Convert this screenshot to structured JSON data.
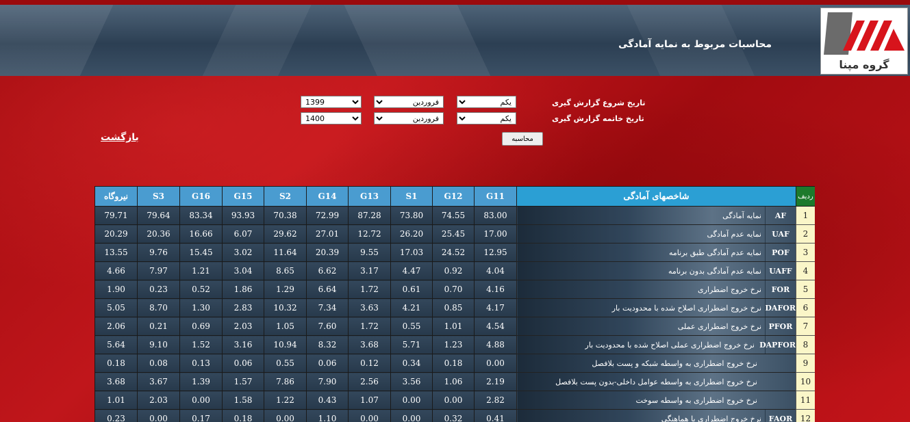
{
  "header": {
    "title": "محاسبات مربوط به نمایه آمادگی",
    "logo_text": "گروه مپنا"
  },
  "form": {
    "start_label": "تاریخ شروع گزارش گیری",
    "end_label": "تاریخ خاتمه گزارش گیری",
    "start_day": "یکم",
    "start_month": "فروردین",
    "start_year": "1399",
    "end_day": "یکم",
    "end_month": "فروردین",
    "end_year": "1400",
    "calc_label": "محاسبه",
    "back_label": "بازگشت"
  },
  "table": {
    "idx_header": "ردیف",
    "name_header": "شاخصهای آمادگی",
    "columns": [
      "G11",
      "G12",
      "S1",
      "G13",
      "G14",
      "S2",
      "G15",
      "G16",
      "S3",
      "نیروگاه"
    ],
    "rows": [
      {
        "idx": "1",
        "abbr": "AF",
        "desc": "نمایه آمادگی",
        "values": [
          "83.00",
          "74.55",
          "73.80",
          "87.28",
          "72.99",
          "70.38",
          "93.93",
          "83.34",
          "79.64",
          "79.71"
        ]
      },
      {
        "idx": "2",
        "abbr": "UAF",
        "desc": "نمایه عدم آمادگی",
        "values": [
          "17.00",
          "25.45",
          "26.20",
          "12.72",
          "27.01",
          "29.62",
          "6.07",
          "16.66",
          "20.36",
          "20.29"
        ]
      },
      {
        "idx": "3",
        "abbr": "POF",
        "desc": "نمایه عدم آمادگی طبق برنامه",
        "values": [
          "12.95",
          "24.52",
          "17.03",
          "9.55",
          "20.39",
          "11.64",
          "3.02",
          "15.45",
          "9.76",
          "13.55"
        ]
      },
      {
        "idx": "4",
        "abbr": "UAFF",
        "desc": "نمایه عدم آمادگی بدون برنامه",
        "values": [
          "4.04",
          "0.92",
          "4.47",
          "3.17",
          "6.62",
          "8.65",
          "3.04",
          "1.21",
          "7.97",
          "4.66"
        ]
      },
      {
        "idx": "5",
        "abbr": "FOR",
        "desc": "نرخ خروج اضطراری",
        "values": [
          "4.16",
          "0.70",
          "0.61",
          "1.72",
          "6.64",
          "1.29",
          "1.86",
          "0.52",
          "0.23",
          "1.90"
        ]
      },
      {
        "idx": "6",
        "abbr": "DAFOR",
        "desc": "نرخ خروج اضطراری اصلاح شده با محدودیت بار",
        "values": [
          "4.17",
          "0.85",
          "4.21",
          "3.63",
          "7.34",
          "10.32",
          "2.83",
          "1.30",
          "8.70",
          "5.05"
        ]
      },
      {
        "idx": "7",
        "abbr": "PFOR",
        "desc": "نرخ خروج اضطراری عملی",
        "values": [
          "4.54",
          "1.01",
          "0.55",
          "1.72",
          "7.60",
          "1.05",
          "2.03",
          "0.69",
          "0.21",
          "2.06"
        ]
      },
      {
        "idx": "8",
        "abbr": "DAPFOR",
        "desc": "نرخ خروج اضطراری عملی اصلاح شده با محدودیت بار",
        "values": [
          "4.88",
          "1.23",
          "5.71",
          "3.68",
          "8.32",
          "10.94",
          "3.16",
          "1.52",
          "9.10",
          "5.64"
        ]
      },
      {
        "idx": "9",
        "abbr": "",
        "desc": "نرخ خروج اضطراری به واسطه شبکه و پست بلافصل",
        "values": [
          "0.00",
          "0.18",
          "0.34",
          "0.12",
          "0.06",
          "0.55",
          "0.06",
          "0.13",
          "0.08",
          "0.18"
        ]
      },
      {
        "idx": "10",
        "abbr": "",
        "desc": "نرخ خروج اضطراری به واسطه عوامل داخلی-بدون پست بلافصل",
        "values": [
          "2.19",
          "1.06",
          "3.56",
          "2.56",
          "7.90",
          "7.86",
          "1.57",
          "1.39",
          "3.67",
          "3.68"
        ]
      },
      {
        "idx": "11",
        "abbr": "",
        "desc": "نرخ خروج اضطراری به واسطه سوخت",
        "values": [
          "2.82",
          "0.00",
          "0.00",
          "1.07",
          "0.43",
          "1.22",
          "1.58",
          "0.00",
          "2.03",
          "1.01"
        ]
      },
      {
        "idx": "12",
        "abbr": "FAOR",
        "desc": "نرخ خروج اضطراری با هماهنگی",
        "values": [
          "0.41",
          "0.32",
          "0.00",
          "0.00",
          "1.10",
          "0.00",
          "0.18",
          "0.17",
          "0.00",
          "0.23"
        ]
      }
    ]
  }
}
